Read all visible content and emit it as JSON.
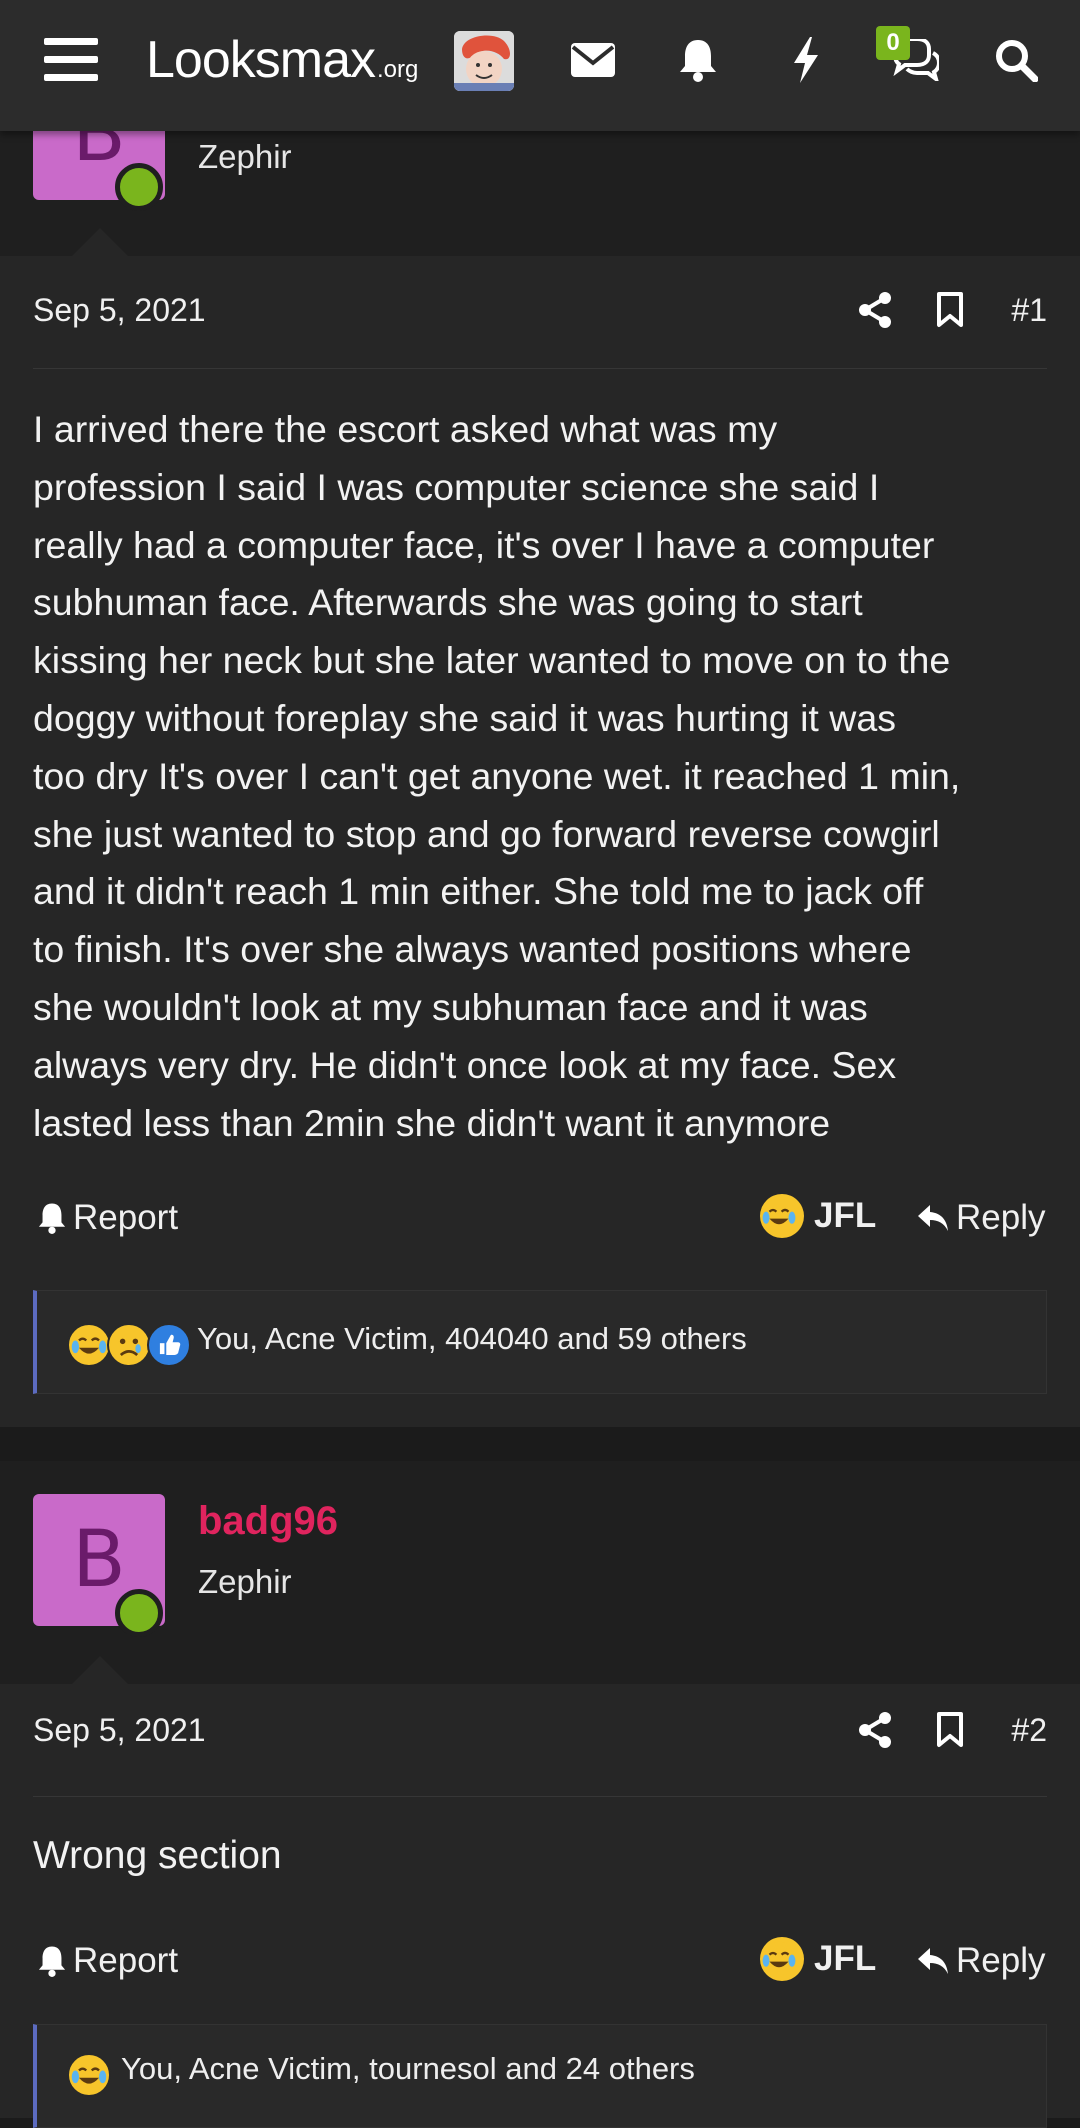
{
  "topbar": {
    "logo_main": "Looksmax",
    "logo_tld": ".org",
    "conversations_badge": "0",
    "icons": [
      "menu-icon",
      "mail-icon",
      "bell-icon",
      "lightning-icon",
      "conversations-icon",
      "search-icon"
    ]
  },
  "posts": [
    {
      "avatar_letter": "B",
      "username": "",
      "user_title": "Zephir",
      "date": "Sep 5, 2021",
      "number": "#1",
      "content": "I arrived there the escort asked what was my\nprofession I said I was computer science she said I\nreally had a computer face, it's over I have a computer\nsubhuman face. Afterwards she was going to start\nkissing her neck but she later wanted to move on to the\ndoggy without foreplay she said it was hurting it was\ntoo dry It's over I can't get anyone wet. it reached 1 min,\nshe just wanted to stop and go forward reverse cowgirl\nand it didn't reach 1 min either. She told me to jack off\nto finish. It's over she always wanted positions where\nshe wouldn't look at my subhuman face and it was\nalways very dry. He didn't once look at my face. Sex\nlasted less than 2min she didn't want it anymore",
      "report_label": "Report",
      "reaction_label": "JFL",
      "reply_label": "Reply",
      "reactions_text": "You, Acne Victim, 404040 and 59 others",
      "reaction_icons": [
        "laughing-crying-emoji",
        "sad-emoji",
        "thumbs-up-emoji"
      ]
    },
    {
      "avatar_letter": "B",
      "username": "badg96",
      "user_title": "Zephir",
      "date": "Sep 5, 2021",
      "number": "#2",
      "content": "Wrong section",
      "report_label": "Report",
      "reaction_label": "JFL",
      "reply_label": "Reply",
      "reactions_text": "You, Acne Victim, tournesol and 24 others",
      "reaction_icons": [
        "laughing-crying-emoji"
      ]
    }
  ],
  "colors": {
    "username": "#e0245e",
    "avatar_bg": "#c96ac9",
    "online": "#7ab51d",
    "reaction_accent": "#5c6bc0"
  }
}
